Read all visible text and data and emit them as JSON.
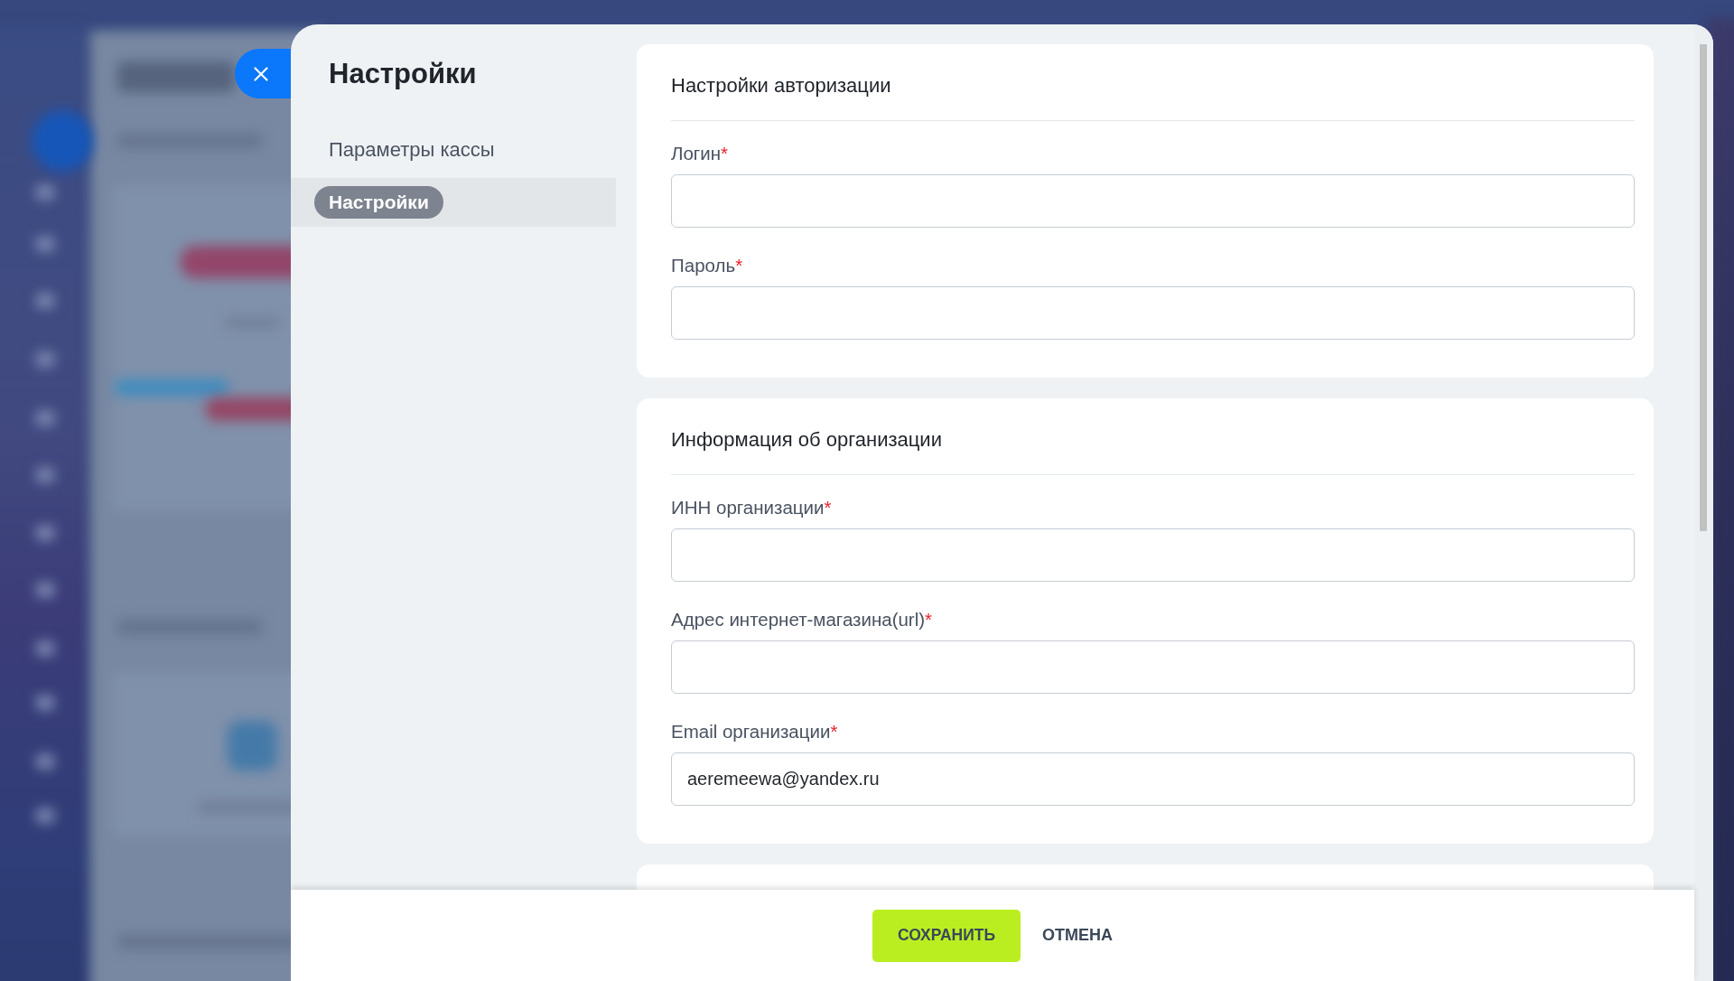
{
  "panel": {
    "title": "Настройки"
  },
  "nav": {
    "items": [
      {
        "label": "Параметры кассы",
        "selected": false
      },
      {
        "label": "Настройки",
        "selected": true
      }
    ]
  },
  "sections": [
    {
      "title": "Настройки авторизации",
      "fields": [
        {
          "label": "Логин",
          "required_mark": "*"
        },
        {
          "label": "Пароль",
          "required_mark": "*"
        }
      ]
    },
    {
      "title": "Информация об организации",
      "fields": [
        {
          "label": "ИНН организации",
          "required_mark": "*"
        },
        {
          "label": "Адрес интернет-магазина(url)",
          "required_mark": "*"
        },
        {
          "label": "Email организации",
          "required_mark": "*",
          "value": "aeremeewa@yandex.ru"
        }
      ]
    }
  ],
  "footer": {
    "buttons": [
      {
        "label": "СОХРАНИТЬ",
        "kind": "primary"
      },
      {
        "label": "ОТМЕНА",
        "kind": "secondary"
      }
    ]
  }
}
